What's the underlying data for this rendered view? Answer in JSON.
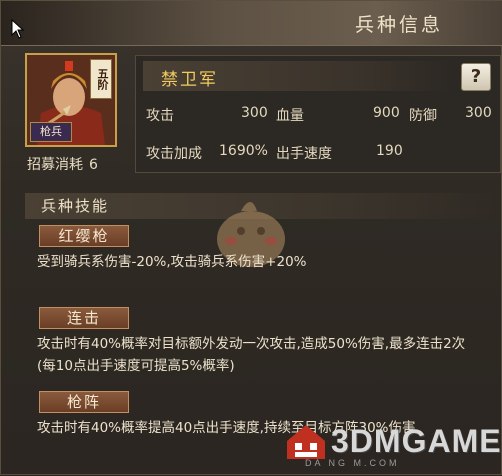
{
  "title": "兵种信息",
  "unit": {
    "name": "禁卫军",
    "rank_badge": "五阶",
    "type_badge": "枪兵",
    "recruit_label": "招募消耗",
    "recruit_value": "6"
  },
  "help_label": "?",
  "stats": {
    "attack_label": "攻击",
    "attack_value": "300",
    "hp_label": "血量",
    "hp_value": "900",
    "defense_label": "防御",
    "defense_value": "300",
    "atk_bonus_label": "攻击加成",
    "atk_bonus_value": "1690%",
    "speed_label": "出手速度",
    "speed_value": "190"
  },
  "skills_title": "兵种技能",
  "skills": [
    {
      "name": "红缨枪",
      "desc": "受到骑兵系伤害-20%,攻击骑兵系伤害+20%"
    },
    {
      "name": "连击",
      "desc": "攻击时有40%概率对目标额外发动一次攻击,造成50%伤害,最多连击2次(每10点出手速度可提高5%概率)"
    },
    {
      "name": "枪阵",
      "desc": "攻击时有40%概率提高40点出手速度,持续至目标方阵30%伤害"
    }
  ],
  "watermark": {
    "text": "3DMGAME",
    "sub": "DA  NG  M.COM"
  },
  "colors": {
    "accent_gold": "#f2cc60",
    "tab_bg": "#7a4a30"
  }
}
